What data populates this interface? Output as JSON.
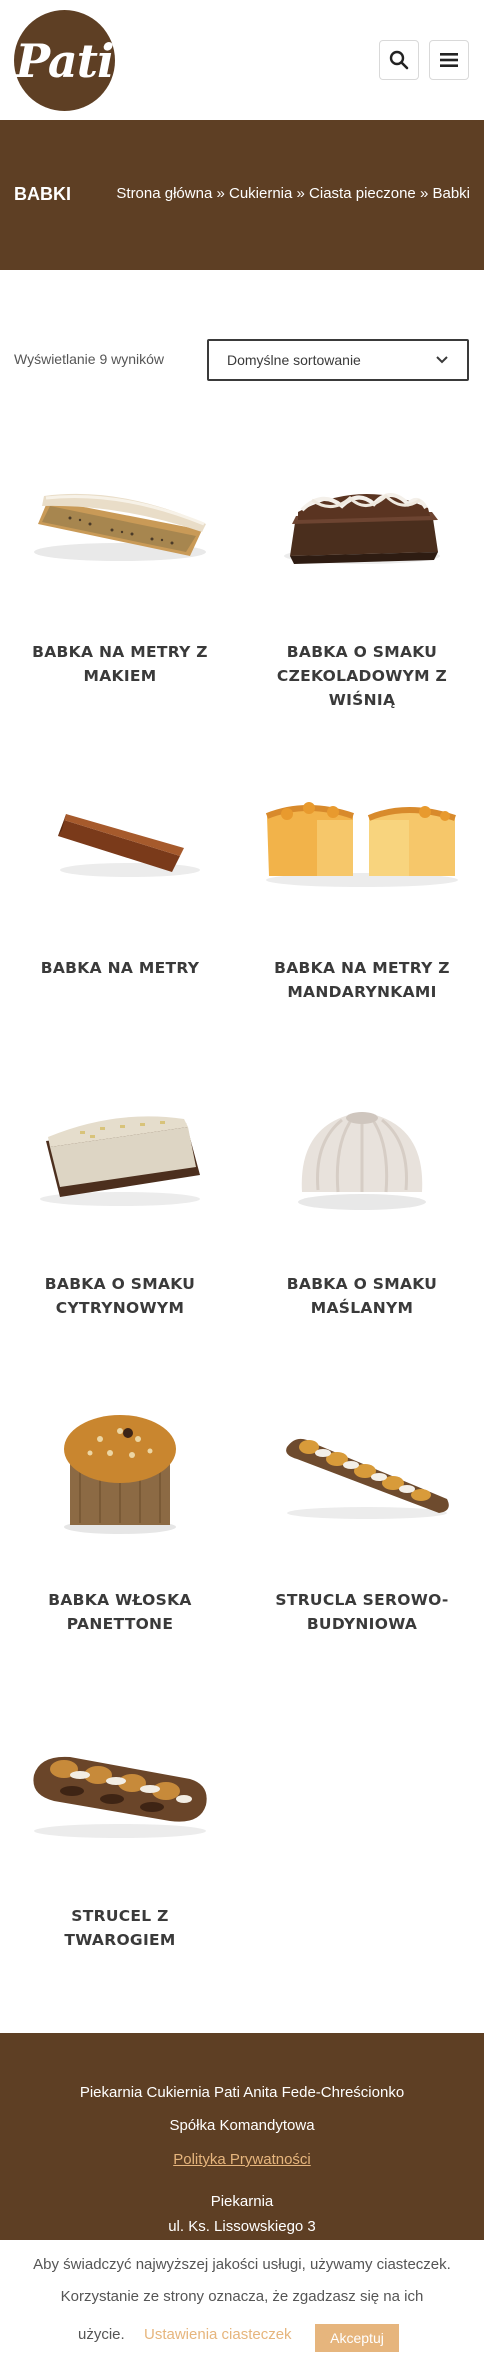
{
  "header": {
    "logo_text": "Pati",
    "search_icon": "search-icon",
    "menu_icon": "hamburger-menu-icon"
  },
  "titlebar": {
    "title": "BABKI",
    "breadcrumb": [
      "Strona główna",
      "Cukiernia",
      "Ciasta pieczone",
      "Babki"
    ],
    "separator": "»"
  },
  "shop": {
    "result_count": "Wyświetlanie 9 wyników",
    "sort_selected": "Domyślne sortowanie"
  },
  "products": [
    {
      "name_lines": [
        "BABKA NA METRY Z",
        "MAKIEM"
      ]
    },
    {
      "name_lines": [
        "BABKA O SMAKU",
        "CZEKOLADOWYM Z",
        "WIŚNIĄ"
      ]
    },
    {
      "name_lines": [
        "BABKA NA METRY"
      ]
    },
    {
      "name_lines": [
        "BABKA NA METRY Z",
        "MANDARYNKAMI"
      ]
    },
    {
      "name_lines": [
        "BABKA O SMAKU",
        "CYTRYNOWYM"
      ]
    },
    {
      "name_lines": [
        "BABKA O SMAKU",
        "MAŚLANYM"
      ]
    },
    {
      "name_lines": [
        "BABKA WŁOSKA",
        "PANETTONE"
      ]
    },
    {
      "name_lines": [
        "STRUCLA SEROWO-",
        "BUDYNIOWA"
      ]
    },
    {
      "name_lines": [
        "STRUCEL Z TWAROGIEM"
      ]
    }
  ],
  "footer": {
    "company": "Piekarnia Cukiernia Pati Anita Fede-Chreścionko",
    "company_type": "Spółka Komandytowa",
    "privacy_link": "Polityka Prywatności",
    "address_title": "Piekarnia",
    "address_line": "ul. Ks. Lissowskiego 3"
  },
  "cookie": {
    "line1": "Aby świadczyć najwyższej jakości usługi, używamy ciasteczek.",
    "line2": "Korzystanie ze strony oznacza, że zgadzasz się na ich",
    "line3": "użycie.",
    "settings_link": "Ustawienia ciasteczek",
    "accept_button": "Akceptuj"
  },
  "colors": {
    "brand_brown": "#5e3f24",
    "accent_gold": "#e6b57d",
    "text_dark": "#3a3a3a"
  }
}
